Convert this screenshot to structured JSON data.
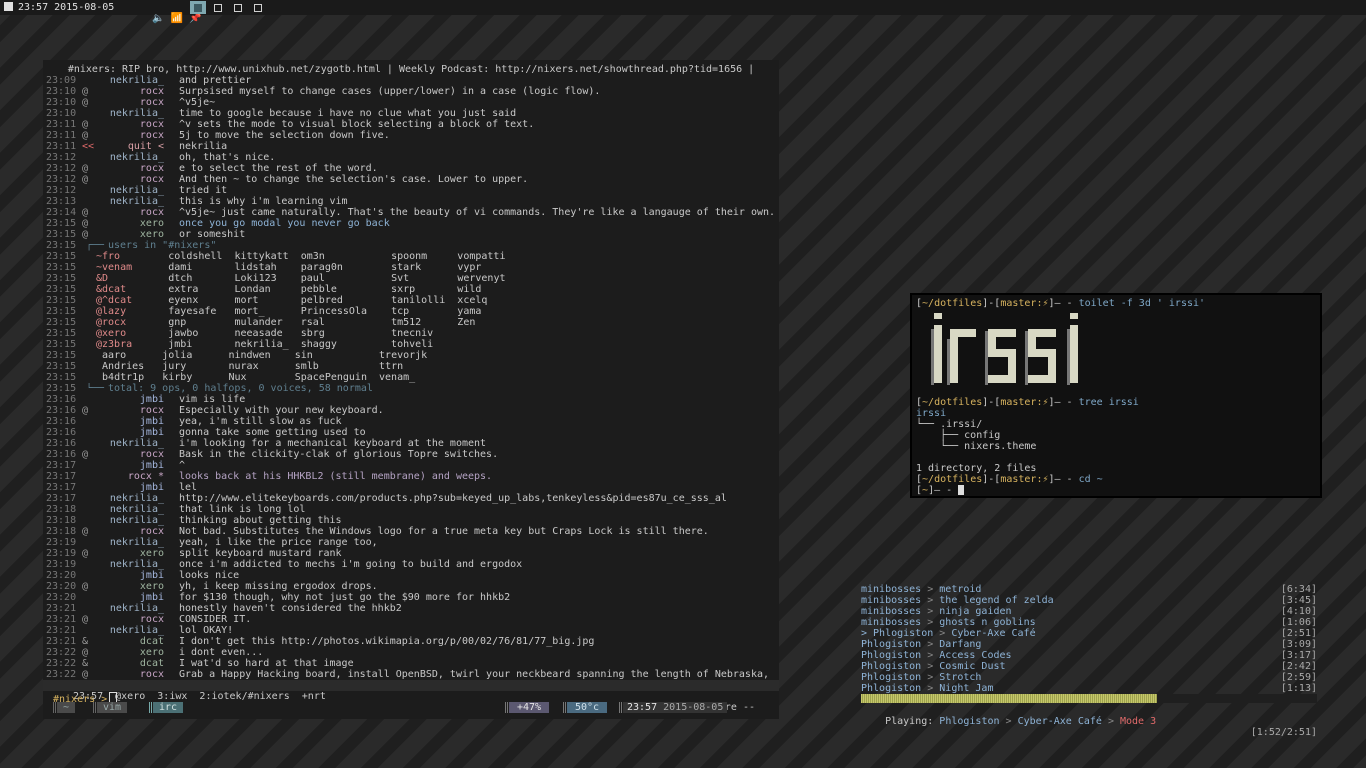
{
  "topbar": {
    "clock": "23:57 2015-08-05",
    "workspaces": [
      {
        "name": "workspace-1",
        "active": true
      },
      {
        "name": "workspace-2",
        "active": false
      },
      {
        "name": "workspace-3",
        "active": false
      },
      {
        "name": "workspace-4",
        "active": false
      }
    ]
  },
  "irc": {
    "topic": "#nixers: RIP bro, http://www.unixhub.net/zygotb.html | Weekly Podcast: http://nixers.net/showthread.php?tid=1656 |",
    "lines": [
      {
        "ts": "23:09",
        "mode": "",
        "nick": "nekrilia_",
        "c": "n1",
        "msg": "and prettier"
      },
      {
        "ts": "23:10",
        "mode": "@",
        "nick": "rocx",
        "c": "n2",
        "msg": "Surpsised myself to change cases (upper/lower) in a case (logic flow)."
      },
      {
        "ts": "23:10",
        "mode": "@",
        "nick": "rocx",
        "c": "n2",
        "msg": "^v5je~"
      },
      {
        "ts": "23:10",
        "mode": "",
        "nick": "nekrilia_",
        "c": "n1",
        "msg": "time to google because i have no clue what you just said"
      },
      {
        "ts": "23:11",
        "mode": "@",
        "nick": "rocx",
        "c": "n2",
        "msg": "^v sets the mode to visual block selecting a block of text."
      },
      {
        "ts": "23:11",
        "mode": "@",
        "nick": "rocx",
        "c": "n2",
        "msg": "5j to move the selection down five."
      },
      {
        "ts": "23:11",
        "mode": "<<",
        "nick": "quit <",
        "c": "n5",
        "msg": "nekrilia"
      },
      {
        "ts": "23:12",
        "mode": "",
        "nick": "nekrilia_",
        "c": "n1",
        "msg": "oh, that's nice."
      },
      {
        "ts": "23:12",
        "mode": "@",
        "nick": "rocx",
        "c": "n2",
        "msg": "e to select the rest of the word."
      },
      {
        "ts": "23:12",
        "mode": "@",
        "nick": "rocx",
        "c": "n2",
        "msg": "And then ~ to change the selection's case. Lower to upper."
      },
      {
        "ts": "23:12",
        "mode": "",
        "nick": "nekrilia_",
        "c": "n1",
        "msg": "tried it"
      },
      {
        "ts": "23:13",
        "mode": "",
        "nick": "nekrilia_",
        "c": "n1",
        "msg": "this is why i'm learning vim"
      },
      {
        "ts": "23:14",
        "mode": "@",
        "nick": "rocx",
        "c": "n2",
        "msg": "^v5je~ just came naturally. That's the beauty of vi commands. They're like a langauge of their own."
      },
      {
        "ts": "23:15",
        "mode": "@",
        "nick": "xero",
        "c": "n3",
        "msg": "once you go modal you never go back",
        "hl": true
      },
      {
        "ts": "23:15",
        "mode": "@",
        "nick": "xero",
        "c": "n3",
        "msg": "or someshit"
      }
    ],
    "users_header": "users in \"#nixers\"",
    "users_ts": "23:15",
    "users_rows": [
      "~fro        coldshell  kittykatt  om3n           spoonm     vompatti",
      "~venam      dami       lidstah    parag0n        stark      vypr",
      "&D          dtch       Loki123    paul           Svt        wervenyt",
      "&dcat       extra      Londan     pebble         sxrp       wild",
      "@^dcat      eyenx      mort       pelbred        tanilolli  xcelq",
      "@lazy       fayesafe   mort_      PrincessOla    tcp        yama",
      "@rocx       gnp        mulander   rsal           tm512      Zen",
      "@xero       jawbo      neeasade   sbrg           tnecniv",
      "@z3bra      jmbi       nekrilia_  shaggy         tohveli",
      " aaro      jolia      nindwen    sin           trevorjk",
      " Andries   jury       nurax      smlb          ttrn",
      " b4dtr1p   kirby      Nux        SpacePenguin  venam_"
    ],
    "users_total": "total: 9 ops, 0 halfops, 0 voices, 58 normal",
    "lines2": [
      {
        "ts": "23:16",
        "mode": "",
        "nick": "jmbi",
        "c": "n4",
        "msg": "vim is life"
      },
      {
        "ts": "23:16",
        "mode": "@",
        "nick": "rocx",
        "c": "n2",
        "msg": "Especially with your new keyboard."
      },
      {
        "ts": "23:16",
        "mode": "",
        "nick": "jmbi",
        "c": "n4",
        "msg": "yea, i'm still slow as fuck"
      },
      {
        "ts": "23:16",
        "mode": "",
        "nick": "jmbi",
        "c": "n4",
        "msg": "gonna take some getting used to"
      },
      {
        "ts": "23:16",
        "mode": "",
        "nick": "nekrilia_",
        "c": "n1",
        "msg": "i'm looking for a mechanical keyboard at the moment"
      },
      {
        "ts": "23:16",
        "mode": "@",
        "nick": "rocx",
        "c": "n2",
        "msg": "Bask in the clickity-clak of glorious Topre switches."
      },
      {
        "ts": "23:17",
        "mode": "",
        "nick": "jmbi",
        "c": "n4",
        "msg": "^"
      },
      {
        "ts": "23:17",
        "mode": "",
        "nick": "rocx *",
        "c": "n2",
        "msg": "looks back at his HHKBL2 (still membrane) and weeps.",
        "act": true
      },
      {
        "ts": "23:17",
        "mode": "",
        "nick": "jmbi",
        "c": "n4",
        "msg": "lel"
      },
      {
        "ts": "23:17",
        "mode": "",
        "nick": "nekrilia_",
        "c": "n1",
        "msg": "http://www.elitekeyboards.com/products.php?sub=keyed_up_labs,tenkeyless&pid=es87u_ce_sss_al"
      },
      {
        "ts": "23:18",
        "mode": "",
        "nick": "nekrilia_",
        "c": "n1",
        "msg": "that link is long lol"
      },
      {
        "ts": "23:18",
        "mode": "",
        "nick": "nekrilia_",
        "c": "n1",
        "msg": "thinking about getting this"
      },
      {
        "ts": "23:18",
        "mode": "@",
        "nick": "rocx",
        "c": "n2",
        "msg": "Not bad. Substitutes the Windows logo for a true meta key but Craps Lock is still there."
      },
      {
        "ts": "23:19",
        "mode": "",
        "nick": "nekrilia_",
        "c": "n1",
        "msg": "yeah, i like the price range too,"
      },
      {
        "ts": "23:19",
        "mode": "@",
        "nick": "xero",
        "c": "n3",
        "msg": "split keyboard mustard rank"
      },
      {
        "ts": "23:19",
        "mode": "",
        "nick": "nekrilia_",
        "c": "n1",
        "msg": "once i'm addicted to mechs i'm going to build and ergodox"
      },
      {
        "ts": "23:20",
        "mode": "",
        "nick": "jmbi",
        "c": "n4",
        "msg": "looks nice"
      },
      {
        "ts": "23:20",
        "mode": "@",
        "nick": "xero",
        "c": "n3",
        "msg": "yh, i keep missing ergodox drops."
      },
      {
        "ts": "23:20",
        "mode": "",
        "nick": "jmbi",
        "c": "n4",
        "msg": "for $130 though, why not just go the $90 more for hhkb2"
      },
      {
        "ts": "23:21",
        "mode": "",
        "nick": "nekrilia_",
        "c": "n1",
        "msg": "honestly haven't considered the hhkb2"
      },
      {
        "ts": "23:21",
        "mode": "@",
        "nick": "rocx",
        "c": "n2",
        "msg": "CONSIDER IT."
      },
      {
        "ts": "23:21",
        "mode": "",
        "nick": "nekrilia_",
        "c": "n1",
        "msg": "lol OKAY!"
      },
      {
        "ts": "23:21",
        "mode": "&",
        "nick": "dcat",
        "c": "n3",
        "msg": "I don't get this http://photos.wikimapia.org/p/00/02/76/81/77_big.jpg"
      },
      {
        "ts": "23:22",
        "mode": "@",
        "nick": "xero",
        "c": "n3",
        "msg": "i dont even..."
      },
      {
        "ts": "23:22",
        "mode": "&",
        "nick": "dcat",
        "c": "n3",
        "msg": "I wat'd so hard at that image"
      },
      {
        "ts": "23:22",
        "mode": "@",
        "nick": "rocx",
        "c": "n2",
        "msg": "Grab a Happy Hacking board, install OpenBSD, twirl your neckbeard spanning the length of Nebraska,"
      }
    ],
    "status_left": "23:57  @xero  3:iwx  2:iotek/#nixers  +nrt",
    "status_right": "-- more --",
    "input_prompt": "#nixers >"
  },
  "tmux": {
    "tabs": [
      "~",
      "vim",
      "irc"
    ],
    "active_tab": 2,
    "cpu": "+47%",
    "temp": "50°c",
    "time": "23:57",
    "date": "2015-08-05"
  },
  "terminal": {
    "lines": [
      {
        "cwd": "~/dotfiles",
        "branch": "master",
        "cmd": "toilet -f 3d ' irssi'"
      },
      {
        "out": "irssi"
      },
      {
        "cwd": "~/dotfiles",
        "branch": "master",
        "cmd": "tree irssi"
      },
      {
        "out": "irssi"
      },
      {
        "out": "└── .irssi/"
      },
      {
        "out": "    ├── config"
      },
      {
        "out": "    └── nixers.theme"
      },
      {
        "out": ""
      },
      {
        "out": "1 directory, 2 files"
      },
      {
        "cwd": "~/dotfiles",
        "branch": "master",
        "cmd": "cd ~"
      },
      {
        "cwd": "~",
        "branch": "",
        "cmd": ""
      }
    ]
  },
  "music": {
    "tracks": [
      {
        "artist": "minibosses",
        "title": "metroid",
        "dur": "[6:34]"
      },
      {
        "artist": "minibosses",
        "title": "the legend of zelda",
        "dur": "[3:45]"
      },
      {
        "artist": "minibosses",
        "title": "ninja gaiden",
        "dur": "[4:10]"
      },
      {
        "artist": "minibosses",
        "title": "ghosts n goblins",
        "dur": "[1:06]"
      },
      {
        "artist": "Phlogiston",
        "title": "Cyber-Axe Café",
        "dur": "[2:51]",
        "current": true
      },
      {
        "artist": "Phlogiston",
        "title": "Darfang",
        "dur": "[3:09]"
      },
      {
        "artist": "Phlogiston",
        "title": "Access Codes",
        "dur": "[3:17]"
      },
      {
        "artist": "Phlogiston",
        "title": "Cosmic Dust",
        "dur": "[2:42]"
      },
      {
        "artist": "Phlogiston",
        "title": "Strotch",
        "dur": "[2:59]"
      },
      {
        "artist": "Phlogiston",
        "title": "Night Jam",
        "dur": "[1:13]"
      }
    ],
    "progress": 0.65,
    "playing_label": "Playing:",
    "playing_artist": "Phlogiston",
    "playing_title": "Cyber-Axe Café",
    "playing_mode": "Mode 3",
    "playing_time": "[1:52/2:51]"
  }
}
